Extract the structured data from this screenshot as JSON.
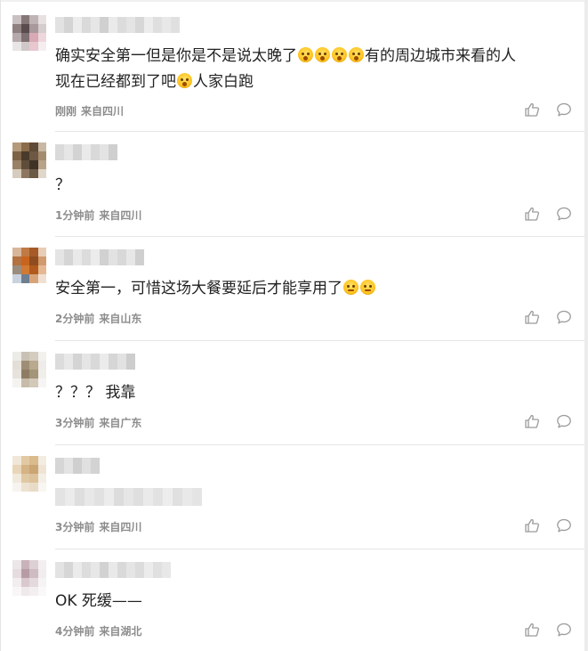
{
  "comments": [
    {
      "text_parts": [
        "确实安全第一但是你是不是说太晚了",
        "有的周边城市来看的人\n现在已经都到了吧",
        "人家白跑"
      ],
      "emoji_name": "shocked-face-emoji",
      "time": "刚刚",
      "location": "来自四川"
    },
    {
      "text": "？",
      "time": "1分钟前",
      "location": "来自四川"
    },
    {
      "text": "安全第一，可惜这场大餐要延后才能享用了",
      "emoji_name": "expressionless-face-emoji",
      "time": "2分钟前",
      "location": "来自山东"
    },
    {
      "text": "？？？ 我靠",
      "time": "3分钟前",
      "location": "来自广东"
    },
    {
      "text": "",
      "time": "3分钟前",
      "location": "来自四川"
    },
    {
      "text": "OK 死缓——",
      "time": "4分钟前",
      "location": "来自湖北"
    }
  ],
  "icons": {
    "like": "thumbs-up-icon",
    "reply": "comment-bubble-icon"
  },
  "colors": {
    "meta_text": "#8d8d8d",
    "body_text": "#222222",
    "divider": "#e5e5e5",
    "icon_stroke": "#9a9a9a"
  }
}
